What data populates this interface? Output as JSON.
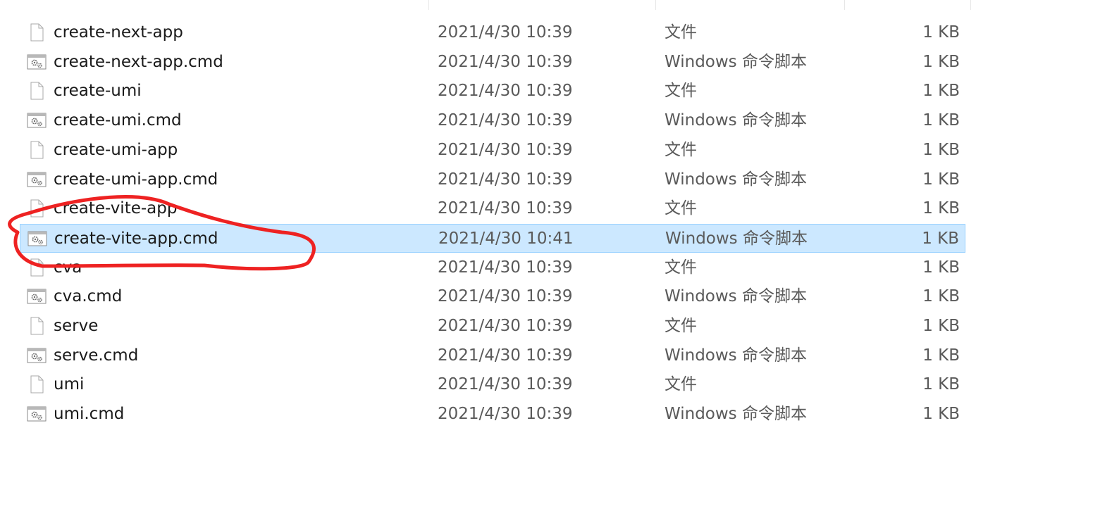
{
  "files": [
    {
      "name": "create-next-app",
      "date": "2021/4/30 10:39",
      "type": "文件",
      "size": "1 KB",
      "icon": "file-icon",
      "selected": false
    },
    {
      "name": "create-next-app.cmd",
      "date": "2021/4/30 10:39",
      "type": "Windows 命令脚本",
      "size": "1 KB",
      "icon": "cmd-script-icon",
      "selected": false
    },
    {
      "name": "create-umi",
      "date": "2021/4/30 10:39",
      "type": "文件",
      "size": "1 KB",
      "icon": "file-icon",
      "selected": false
    },
    {
      "name": "create-umi.cmd",
      "date": "2021/4/30 10:39",
      "type": "Windows 命令脚本",
      "size": "1 KB",
      "icon": "cmd-script-icon",
      "selected": false
    },
    {
      "name": "create-umi-app",
      "date": "2021/4/30 10:39",
      "type": "文件",
      "size": "1 KB",
      "icon": "file-icon",
      "selected": false
    },
    {
      "name": "create-umi-app.cmd",
      "date": "2021/4/30 10:39",
      "type": "Windows 命令脚本",
      "size": "1 KB",
      "icon": "cmd-script-icon",
      "selected": false
    },
    {
      "name": "create-vite-app",
      "date": "2021/4/30 10:39",
      "type": "文件",
      "size": "1 KB",
      "icon": "file-icon",
      "selected": false
    },
    {
      "name": "create-vite-app.cmd",
      "date": "2021/4/30 10:41",
      "type": "Windows 命令脚本",
      "size": "1 KB",
      "icon": "cmd-script-icon",
      "selected": true
    },
    {
      "name": "cva",
      "date": "2021/4/30 10:39",
      "type": "文件",
      "size": "1 KB",
      "icon": "file-icon",
      "selected": false
    },
    {
      "name": "cva.cmd",
      "date": "2021/4/30 10:39",
      "type": "Windows 命令脚本",
      "size": "1 KB",
      "icon": "cmd-script-icon",
      "selected": false
    },
    {
      "name": "serve",
      "date": "2021/4/30 10:39",
      "type": "文件",
      "size": "1 KB",
      "icon": "file-icon",
      "selected": false
    },
    {
      "name": "serve.cmd",
      "date": "2021/4/30 10:39",
      "type": "Windows 命令脚本",
      "size": "1 KB",
      "icon": "cmd-script-icon",
      "selected": false
    },
    {
      "name": "umi",
      "date": "2021/4/30 10:39",
      "type": "文件",
      "size": "1 KB",
      "icon": "file-icon",
      "selected": false
    },
    {
      "name": "umi.cmd",
      "date": "2021/4/30 10:39",
      "type": "Windows 命令脚本",
      "size": "1 KB",
      "icon": "cmd-script-icon",
      "selected": false
    }
  ],
  "colors": {
    "selection_fill": "#cce8ff",
    "selection_border": "#99d1ff",
    "annotation_stroke": "#ee2222",
    "name_text": "#1a1a1a",
    "detail_text": "#5a5a5a"
  }
}
